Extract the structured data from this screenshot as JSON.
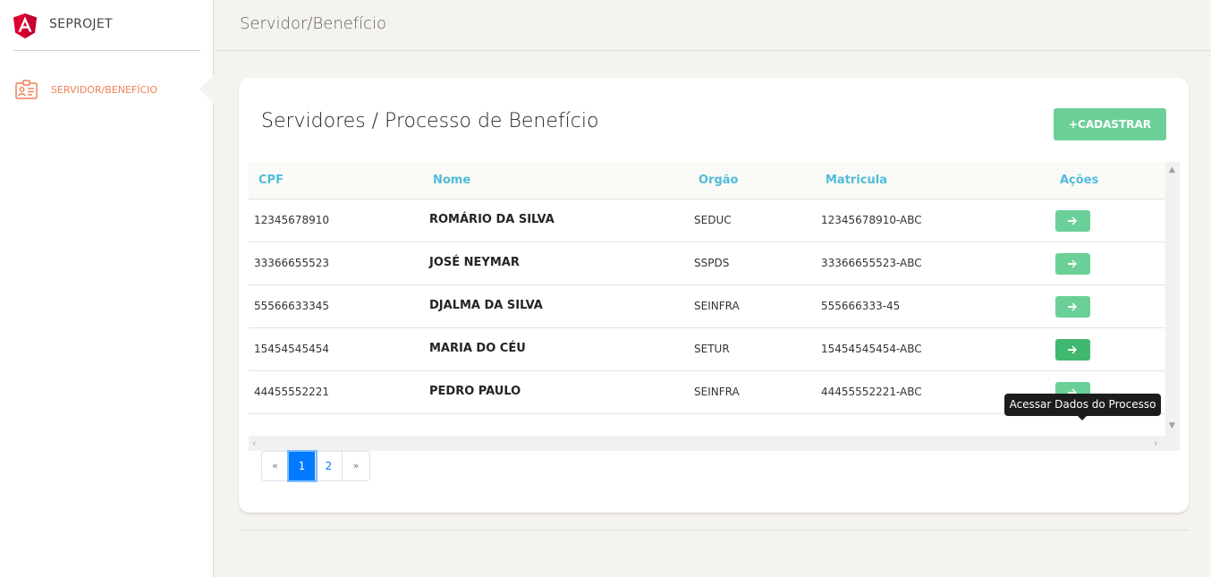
{
  "sidebar": {
    "brand": "SEPROJET",
    "nav_items": [
      {
        "label": "SERVIDOR/BENEFÍCIO",
        "icon": "id-card-icon",
        "active": true
      }
    ]
  },
  "topbar": {
    "title": "Servidor/Benefício"
  },
  "card": {
    "title": "Servidores / Processo de Benefício",
    "add_button": "+CADASTRAR"
  },
  "table": {
    "headers": [
      "CPF",
      "Nome",
      "Orgão",
      "Matricula",
      "Ações"
    ],
    "rows": [
      {
        "cpf": "12345678910",
        "nome": "ROMÁRIO DA SILVA",
        "orgao": "SEDUC",
        "matricula": "12345678910-ABC"
      },
      {
        "cpf": "33366655523",
        "nome": "JOSÉ NEYMAR",
        "orgao": "SSPDS",
        "matricula": "33366655523-ABC"
      },
      {
        "cpf": "55566633345",
        "nome": "DJALMA DA SILVA",
        "orgao": "SEINFRA",
        "matricula": "555666333-45"
      },
      {
        "cpf": "15454545454",
        "nome": "MARIA DO CÉU",
        "orgao": "SETUR",
        "matricula": "15454545454-ABC"
      },
      {
        "cpf": "44455552221",
        "nome": "PEDRO PAULO",
        "orgao": "SEINFRA",
        "matricula": "44455552221-ABC"
      }
    ]
  },
  "tooltip": {
    "text": "Acessar Dados do Processo"
  },
  "pagination": {
    "prev": "«",
    "pages": [
      "1",
      "2"
    ],
    "current": "1",
    "next": "»"
  },
  "colors": {
    "accent_orange": "#ef8157",
    "header_cyan": "#51bcda",
    "button_green": "#6bd098",
    "page_blue": "#007bff"
  }
}
